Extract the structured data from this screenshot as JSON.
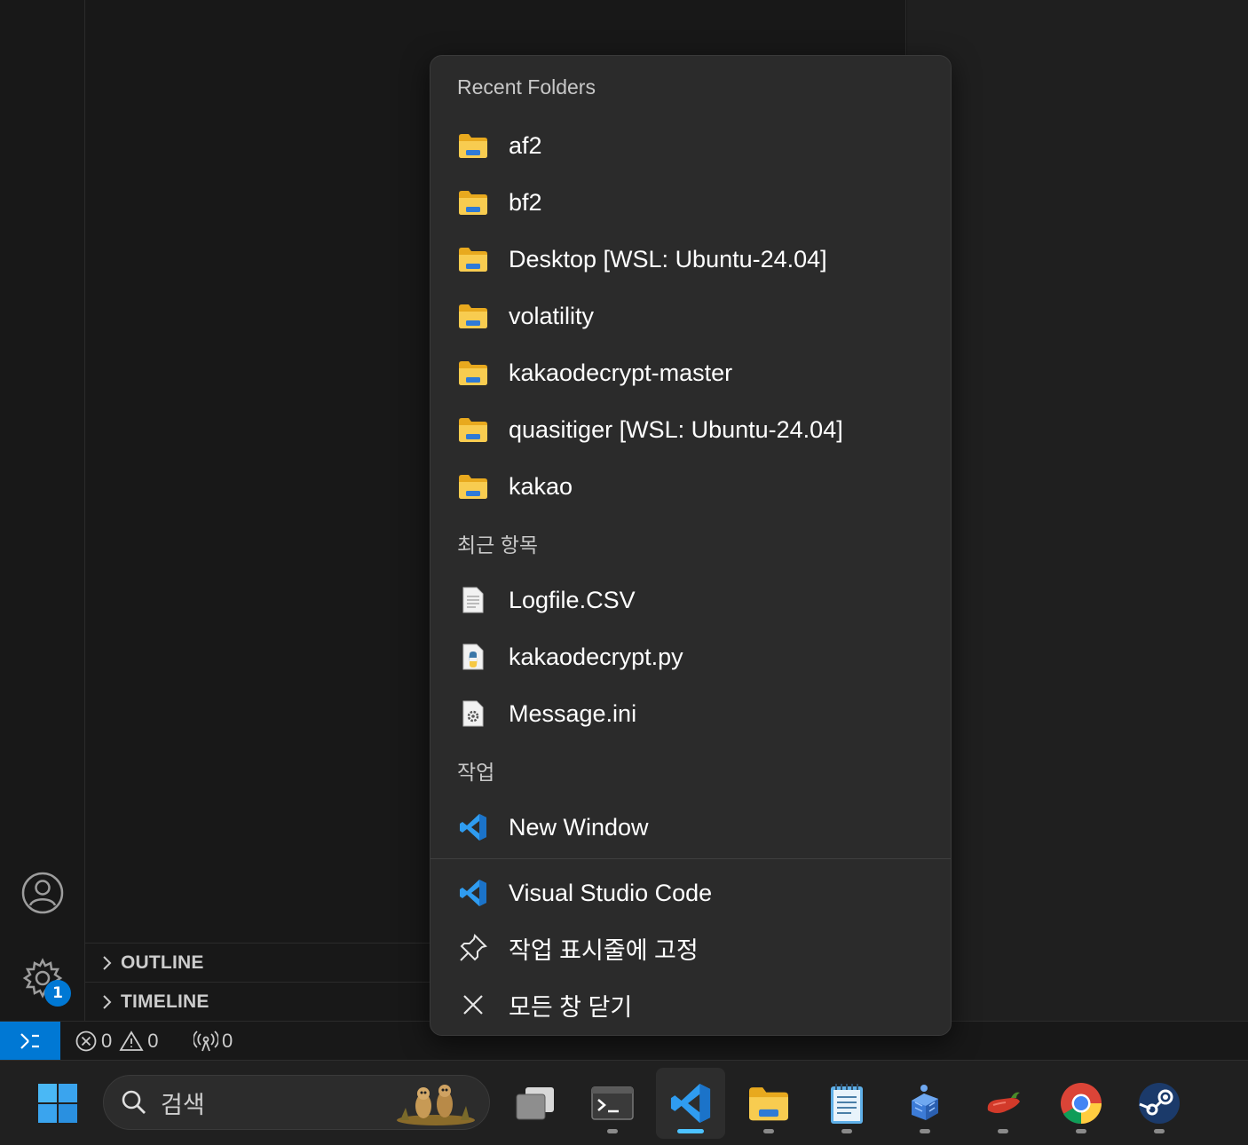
{
  "statusbar": {
    "errors": "0",
    "warnings": "0",
    "ports": "0"
  },
  "sidebar": {
    "outline_label": "OUTLINE",
    "timeline_label": "TIMELINE",
    "settings_badge": "1"
  },
  "jumplist": {
    "recent_folders_header": "Recent Folders",
    "folders": [
      {
        "label": "af2",
        "icon": "folder-icon"
      },
      {
        "label": "bf2",
        "icon": "folder-icon"
      },
      {
        "label": "Desktop [WSL: Ubuntu-24.04]",
        "icon": "folder-icon"
      },
      {
        "label": "volatility",
        "icon": "folder-icon"
      },
      {
        "label": "kakaodecrypt-master",
        "icon": "folder-icon"
      },
      {
        "label": "quasitiger [WSL: Ubuntu-24.04]",
        "icon": "folder-icon"
      },
      {
        "label": "kakao",
        "icon": "folder-icon"
      }
    ],
    "recent_items_header": "최근 항목",
    "recent_items": [
      {
        "label": "Logfile.CSV",
        "icon": "text-file-icon"
      },
      {
        "label": "kakaodecrypt.py",
        "icon": "python-file-icon"
      },
      {
        "label": "Message.ini",
        "icon": "settings-file-icon"
      }
    ],
    "tasks_header": "작업",
    "tasks": [
      {
        "label": "New Window",
        "icon": "vscode-icon"
      }
    ],
    "actions": [
      {
        "label": "Visual Studio Code",
        "icon": "vscode-icon"
      },
      {
        "label": "작업 표시줄에 고정",
        "icon": "pin-icon"
      },
      {
        "label": "모든 창 닫기",
        "icon": "close-icon"
      }
    ]
  },
  "taskbar": {
    "search_placeholder": "검색",
    "apps": [
      "start-icon",
      "task-view-icon",
      "terminal-icon",
      "vscode-icon",
      "file-explorer-icon",
      "notepad-icon",
      "docker-icon",
      "pepper-app-icon",
      "chrome-icon",
      "steam-icon"
    ]
  },
  "colors": {
    "accent": "#0078d4",
    "taskbar_active": "#4cc2ff",
    "folder_yellow": "#f5c542"
  }
}
